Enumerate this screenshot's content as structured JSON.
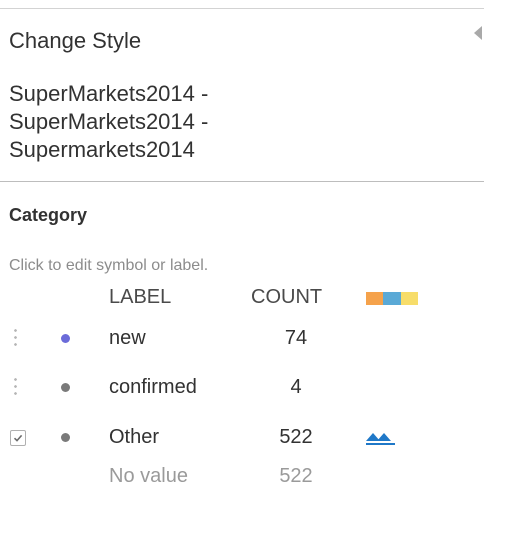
{
  "panel": {
    "title": "Change Style",
    "layer_name": "SuperMarkets2014 -\nSuperMarkets2014 -\nSupermarkets2014"
  },
  "category": {
    "title": "Category",
    "hint": "Click to edit symbol or label.",
    "header_label": "LABEL",
    "header_count": "COUNT",
    "ramp_colors": [
      "#f5a24b",
      "#5aa9d6",
      "#f7dd6a"
    ]
  },
  "rows": [
    {
      "label": "new",
      "count": "74",
      "color": "#6b6bd9"
    },
    {
      "label": "confirmed",
      "count": "4",
      "color": "#7a7a7a"
    },
    {
      "label": "Other",
      "count": "522",
      "color": "#7a7a7a",
      "checked": true,
      "icon": "double-up-arrow-icon"
    }
  ],
  "no_value": {
    "label": "No value",
    "count": "522"
  }
}
